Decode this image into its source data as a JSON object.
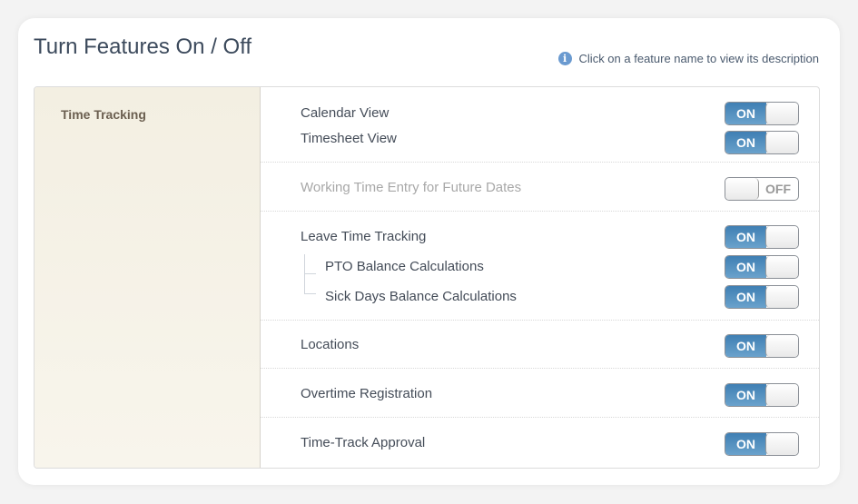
{
  "header": {
    "title": "Turn Features On / Off",
    "hint": "Click on a feature name to view its description",
    "hint_icon": "info-icon"
  },
  "sidebar": {
    "category": "Time Tracking"
  },
  "colors": {
    "toggle_on": "#4f8dbf",
    "accent": "#6a9ad0"
  },
  "features": [
    {
      "label": "Calendar View",
      "state": "ON"
    },
    {
      "label": "Timesheet View",
      "state": "ON"
    },
    {
      "label": "Working Time Entry for Future Dates",
      "state": "OFF"
    },
    {
      "label": "Leave Time Tracking",
      "state": "ON"
    },
    {
      "label": "PTO Balance Calculations",
      "state": "ON"
    },
    {
      "label": "Sick Days Balance Calculations",
      "state": "ON"
    },
    {
      "label": "Locations",
      "state": "ON"
    },
    {
      "label": "Overtime Registration",
      "state": "ON"
    },
    {
      "label": "Time-Track Approval",
      "state": "ON"
    }
  ]
}
